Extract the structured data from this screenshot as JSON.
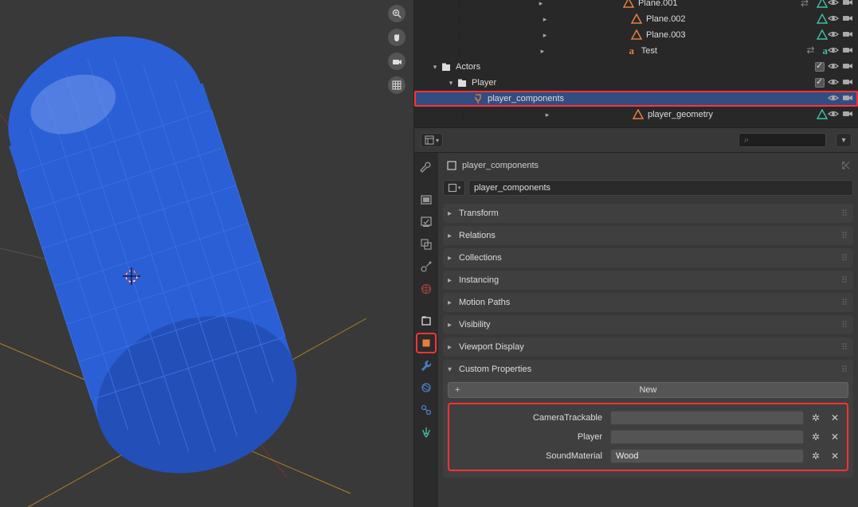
{
  "outliner": {
    "items": [
      {
        "indent": 56,
        "tri": "right",
        "icon": "mesh",
        "name": "Plane.001",
        "aux": [
          "link",
          "mod"
        ]
      },
      {
        "indent": 56,
        "tri": "right",
        "icon": "mesh",
        "name": "Plane.002",
        "aux": [
          "mod"
        ]
      },
      {
        "indent": 56,
        "tri": "right",
        "icon": "mesh",
        "name": "Plane.003",
        "aux": [
          "mod"
        ]
      },
      {
        "indent": 56,
        "tri": "right",
        "icon": "text",
        "name": "Test",
        "aux": [
          "link",
          "text"
        ]
      },
      {
        "indent": 20,
        "tri": "down",
        "icon": "collection",
        "name": "Actors",
        "aux": [],
        "chk": true
      },
      {
        "indent": 40,
        "tri": "down",
        "icon": "collection",
        "name": "Player",
        "aux": [],
        "chk": true
      },
      {
        "indent": 60,
        "tri": "none",
        "icon": "armature",
        "name": "player_components",
        "aux": [],
        "selected": true,
        "hl": true
      },
      {
        "indent": 60,
        "tri": "right",
        "icon": "mesh",
        "name": "player_geometry",
        "aux": [
          "mod"
        ]
      }
    ]
  },
  "properties": {
    "breadcrumb": "player_components",
    "name_value": "player_components",
    "search_placeholder": "",
    "panels": [
      "Transform",
      "Relations",
      "Collections",
      "Instancing",
      "Motion Paths",
      "Visibility",
      "Viewport Display",
      "Custom Properties"
    ],
    "new_button_label": "New",
    "custom_props": [
      {
        "label": "CameraTrackable",
        "value": ""
      },
      {
        "label": "Player",
        "value": ""
      },
      {
        "label": "SoundMaterial",
        "value": "Wood"
      }
    ]
  }
}
